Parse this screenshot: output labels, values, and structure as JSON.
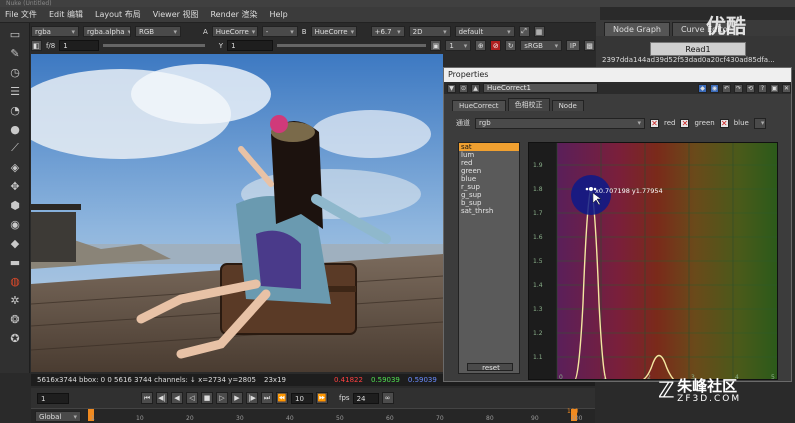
{
  "window": {
    "title": "Nuke (Untitled)"
  },
  "menu": {
    "items": [
      "File 文件",
      "Edit 编辑",
      "Layout 布局",
      "Viewer 视图",
      "Render 渲染",
      "Help"
    ]
  },
  "viewer_controls": {
    "channel_layer": "rgba",
    "alpha": "rgba.alpha",
    "display": "RGB",
    "a_label": "A",
    "a_input": "HueCorre",
    "a_dash": "-",
    "b_label": "B",
    "b_input": "HueCorre",
    "gain": "+6.7",
    "view_2d": "2D",
    "lut": "default",
    "frame_label": "f/8",
    "frame_value": "1",
    "y_label": "Y",
    "y_value": "1",
    "proxy_value": "1",
    "colorspace": "sRGB",
    "ip_label": "IP"
  },
  "status_bar": {
    "info": "5616x3744 bbox: 0 0 5616 3744 channels: ↓ x=2734 y=2805",
    "size": "23x19",
    "r": "0.41822",
    "g": "0.59039",
    "b": "0.59039",
    "a": "0.00000"
  },
  "timeline": {
    "start_frame": "1",
    "step": "10",
    "fps_label": "fps",
    "fps": "24",
    "layout": "Global",
    "end_frame": "100",
    "ruler": [
      "1",
      "10",
      "20",
      "30",
      "40",
      "50",
      "60",
      "70",
      "80",
      "90",
      "100"
    ]
  },
  "panel_tabs": {
    "node_graph": "Node Graph",
    "curve_editor": "Curve Editor"
  },
  "node_graph": {
    "node_label": "Read1",
    "hash": "2397dda144ad39d52f53dad0a20cf430ad85dfa..."
  },
  "properties": {
    "title": "Properties",
    "node_name": "HueCorrect1",
    "tabs": [
      "HueCorrect",
      "色相校正",
      "Node"
    ],
    "channels_label": "通道",
    "channels_value": "rgb",
    "channel_toggles": [
      "red",
      "green",
      "blue"
    ],
    "curves": [
      "sat",
      "lum",
      "red",
      "green",
      "blue",
      "r_sup",
      "g_sup",
      "b_sup",
      "sat_thrsh"
    ],
    "selected_curve": "sat",
    "reset": "reset",
    "y_ticks": [
      "1.9",
      "1.8",
      "1.7",
      "1.6",
      "1.5",
      "1.4",
      "1.3",
      "1.2",
      "1.1"
    ],
    "cursor_readout": "x0.707198 y1.77954",
    "x_ticks": [
      "0",
      "1",
      "2",
      "3",
      "4",
      "5"
    ]
  },
  "watermarks": {
    "top_right": "优酷",
    "brand": "朱峰社区",
    "url": "ZF3D.COM"
  }
}
